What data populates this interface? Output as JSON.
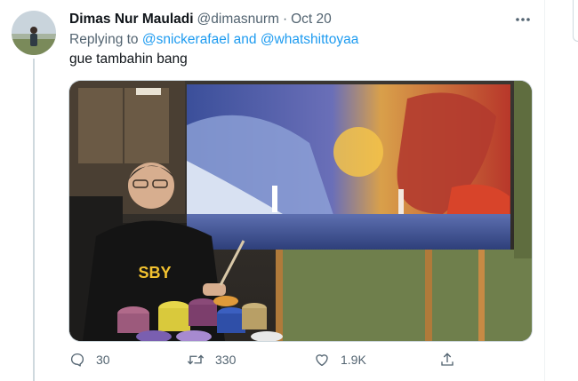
{
  "tweet": {
    "author_name": "Dimas Nur Mauladi",
    "author_handle": "@dimasnurm",
    "separator": "·",
    "date": "Oct 20",
    "replying_prefix": "Replying to",
    "reply_to_1": "@snickerafael",
    "reply_joiner": "and",
    "reply_to_2": "@whatshittoyaa",
    "text": "gue tambahin bang",
    "media_shirt_text": "SBY"
  },
  "actions": {
    "reply_count": "30",
    "retweet_count": "330",
    "like_count": "1.9K"
  },
  "colors": {
    "link": "#1d9bf0",
    "secondary_text": "#536471",
    "primary_text": "#0f1419"
  },
  "icons": [
    "more-icon",
    "reply-icon",
    "retweet-icon",
    "like-icon",
    "share-icon"
  ]
}
